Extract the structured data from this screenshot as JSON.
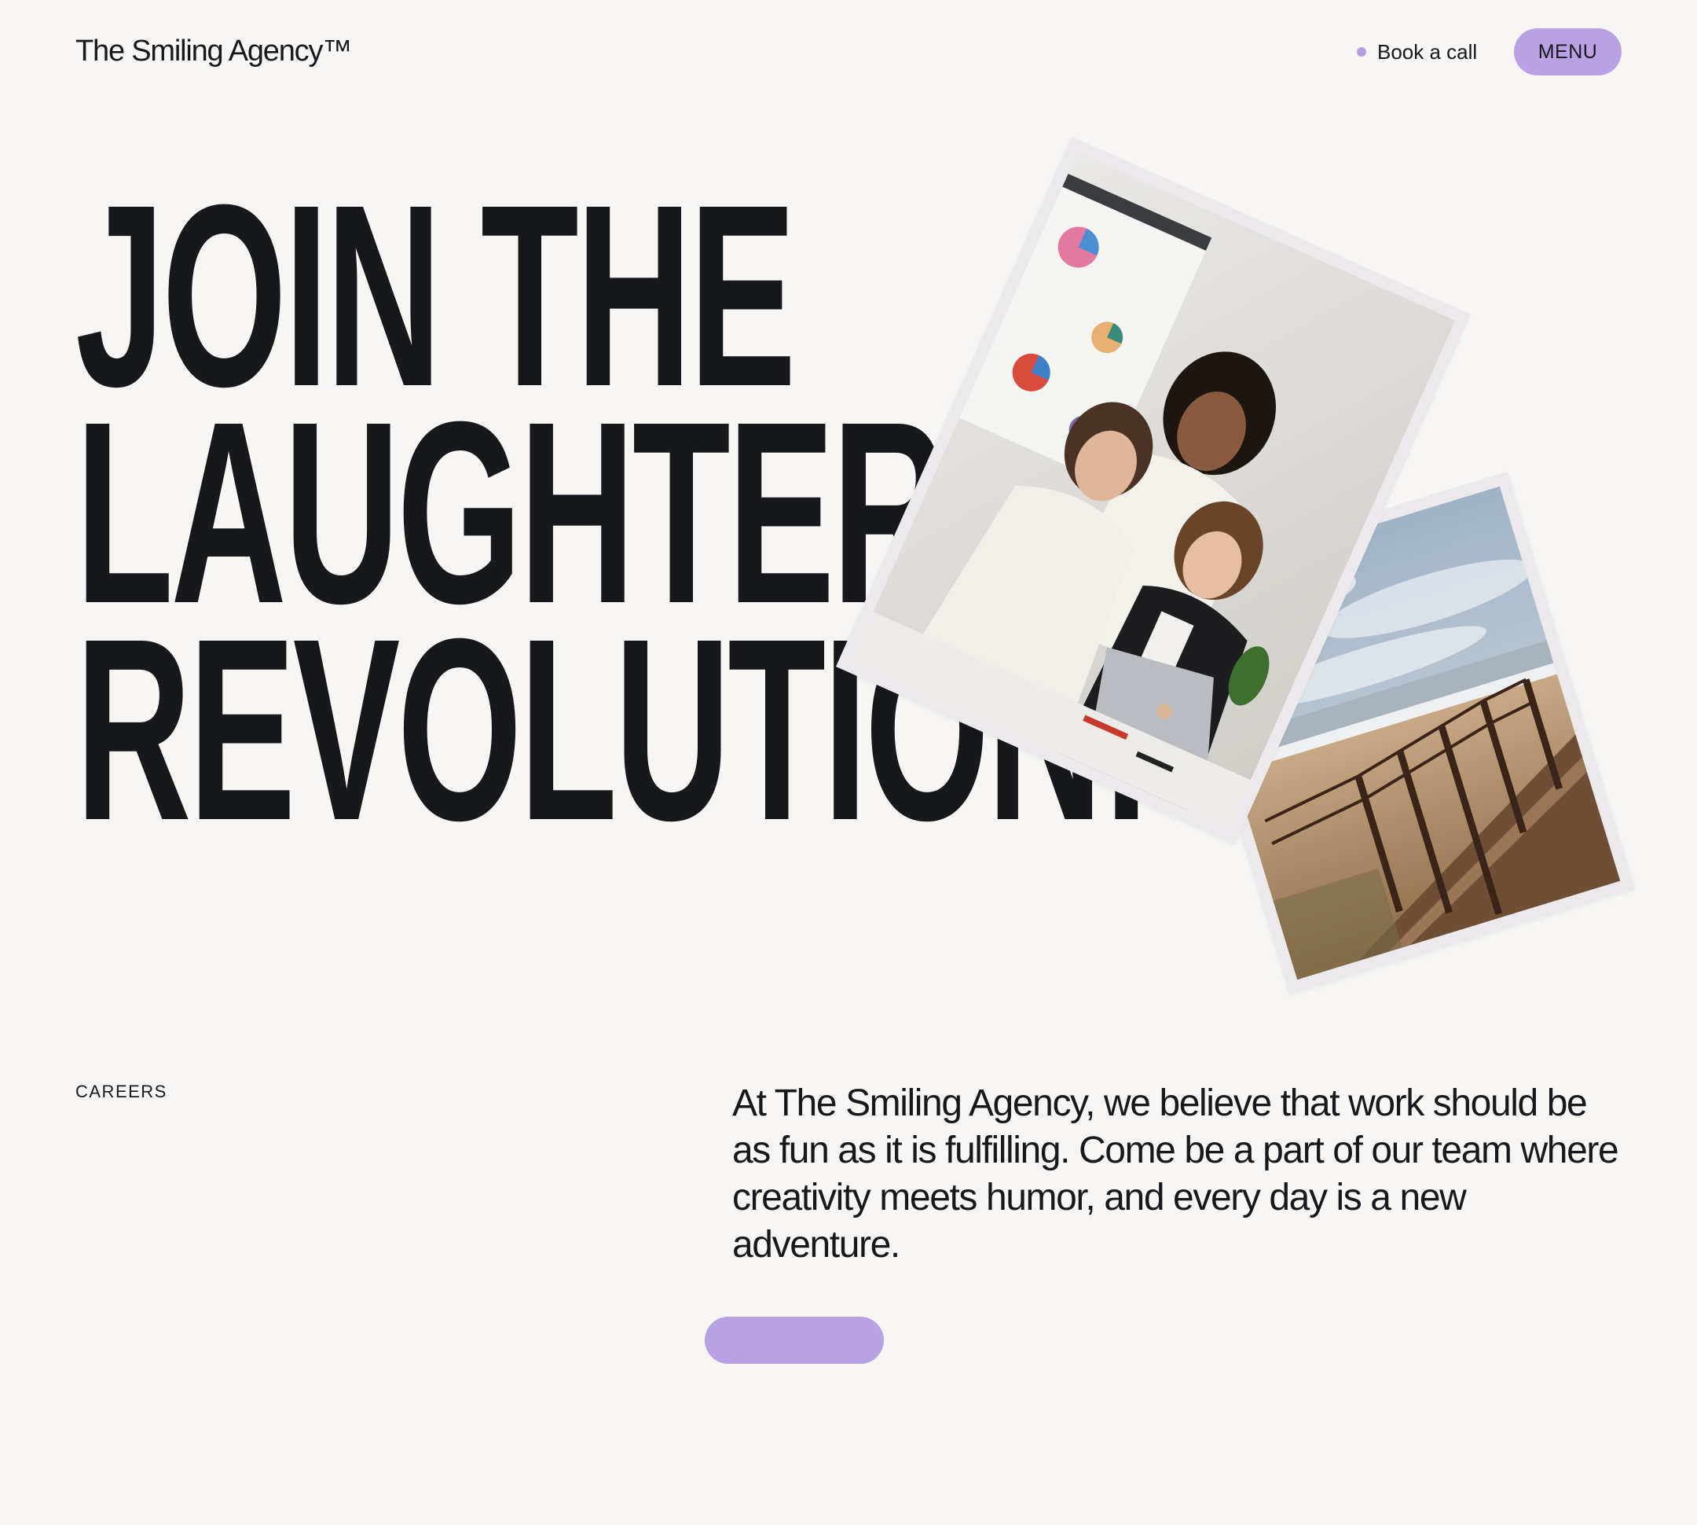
{
  "header": {
    "logo": "The Smiling Agency™",
    "book_call_label": "Book a call",
    "menu_label": "MENU"
  },
  "hero": {
    "headline_lines": [
      "JOIN THE",
      "LAUGHTER",
      "REVOLUTION!"
    ]
  },
  "careers": {
    "section_label": "CAREERS",
    "intro_text": "At The Smiling Agency, we believe that work should be as fun as it is fulfilling. Come be a part of our team where creativity meets humor, and every day is a new adventure.",
    "cta_label": ""
  },
  "colors": {
    "background": "#f7f6f4",
    "text": "#17181c",
    "accent": "#b8a2e3",
    "dot": "#b39ee0"
  },
  "icons": {
    "book_call_indicator": "dot-icon"
  }
}
